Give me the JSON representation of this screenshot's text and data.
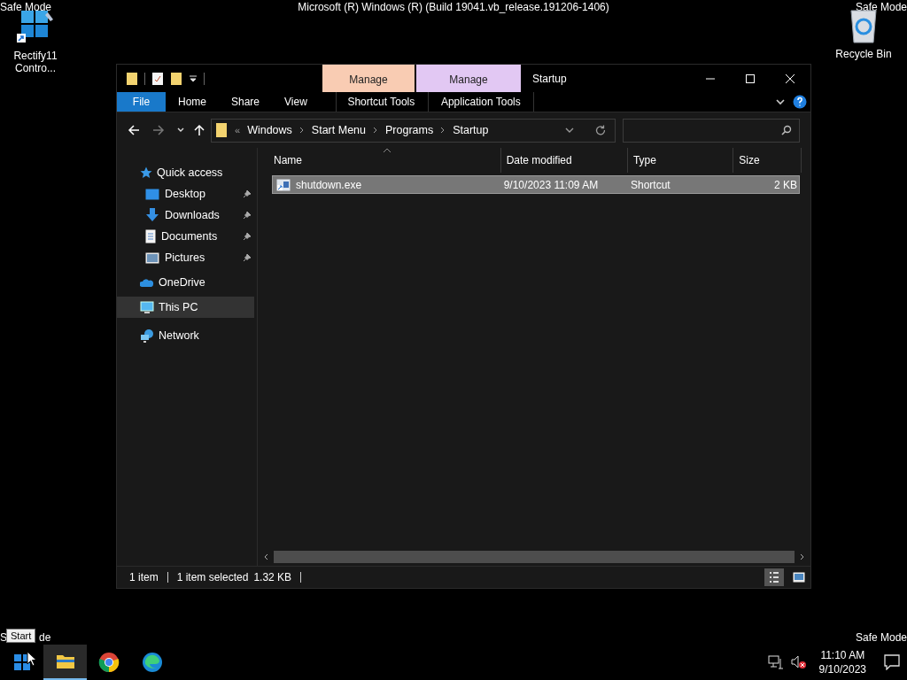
{
  "desktop": {
    "banner": "Microsoft (R) Windows (R) (Build 19041.vb_release.191206-1406)",
    "corner_top_left": "Safe Mode",
    "corner_top_right": "Safe Mode",
    "corner_bottom_right": "Safe Mode",
    "corner_bottom_left": {
      "start": "S",
      "end": "de"
    },
    "icons": [
      {
        "kind": "app",
        "label": "Rectify11 Contro..."
      },
      {
        "kind": "recycle",
        "label": "Recycle Bin"
      }
    ]
  },
  "explorer": {
    "title": "Startup",
    "context_tabs": [
      {
        "group": "Manage",
        "label": "Shortcut Tools",
        "color": "#f9ccb3"
      },
      {
        "group": "Manage",
        "label": "Application Tools",
        "color": "#e2c8f3"
      }
    ],
    "ribbon_tabs": [
      {
        "label": "File",
        "selected": true
      },
      {
        "label": "Home",
        "selected": false
      },
      {
        "label": "Share",
        "selected": false
      },
      {
        "label": "View",
        "selected": false
      }
    ],
    "address": {
      "overflow": "«",
      "crumbs": [
        "Windows",
        "Start Menu",
        "Programs",
        "Startup"
      ]
    },
    "nav": [
      {
        "kind": "star",
        "label": "Quick access",
        "selected": false,
        "children": [
          {
            "kind": "desktop",
            "label": "Desktop",
            "pinned": true
          },
          {
            "kind": "download",
            "label": "Downloads",
            "pinned": true
          },
          {
            "kind": "document",
            "label": "Documents",
            "pinned": true
          },
          {
            "kind": "pictures",
            "label": "Pictures",
            "pinned": true
          }
        ]
      },
      {
        "kind": "cloud",
        "label": "OneDrive",
        "selected": false
      },
      {
        "kind": "pc",
        "label": "This PC",
        "selected": true
      },
      {
        "kind": "network",
        "label": "Network",
        "selected": false
      }
    ],
    "columns": [
      "Name",
      "Date modified",
      "Type",
      "Size"
    ],
    "rows": [
      {
        "name": "shutdown.exe",
        "date": "9/10/2023 11:09 AM",
        "type": "Shortcut",
        "size": "2 KB",
        "selected": true
      }
    ],
    "status": {
      "count": "1 item",
      "selection": "1 item selected",
      "size": "1.32 KB"
    },
    "views": [
      {
        "kind": "details",
        "selected": true
      },
      {
        "kind": "tiles",
        "selected": false
      }
    ]
  },
  "taskbar": {
    "tooltip": "Start",
    "apps": [
      {
        "kind": "start",
        "active": false
      },
      {
        "kind": "folder",
        "active": true
      },
      {
        "kind": "chrome",
        "active": false
      },
      {
        "kind": "edge",
        "active": false
      }
    ],
    "time": "11:10 AM",
    "date": "9/10/2023"
  }
}
